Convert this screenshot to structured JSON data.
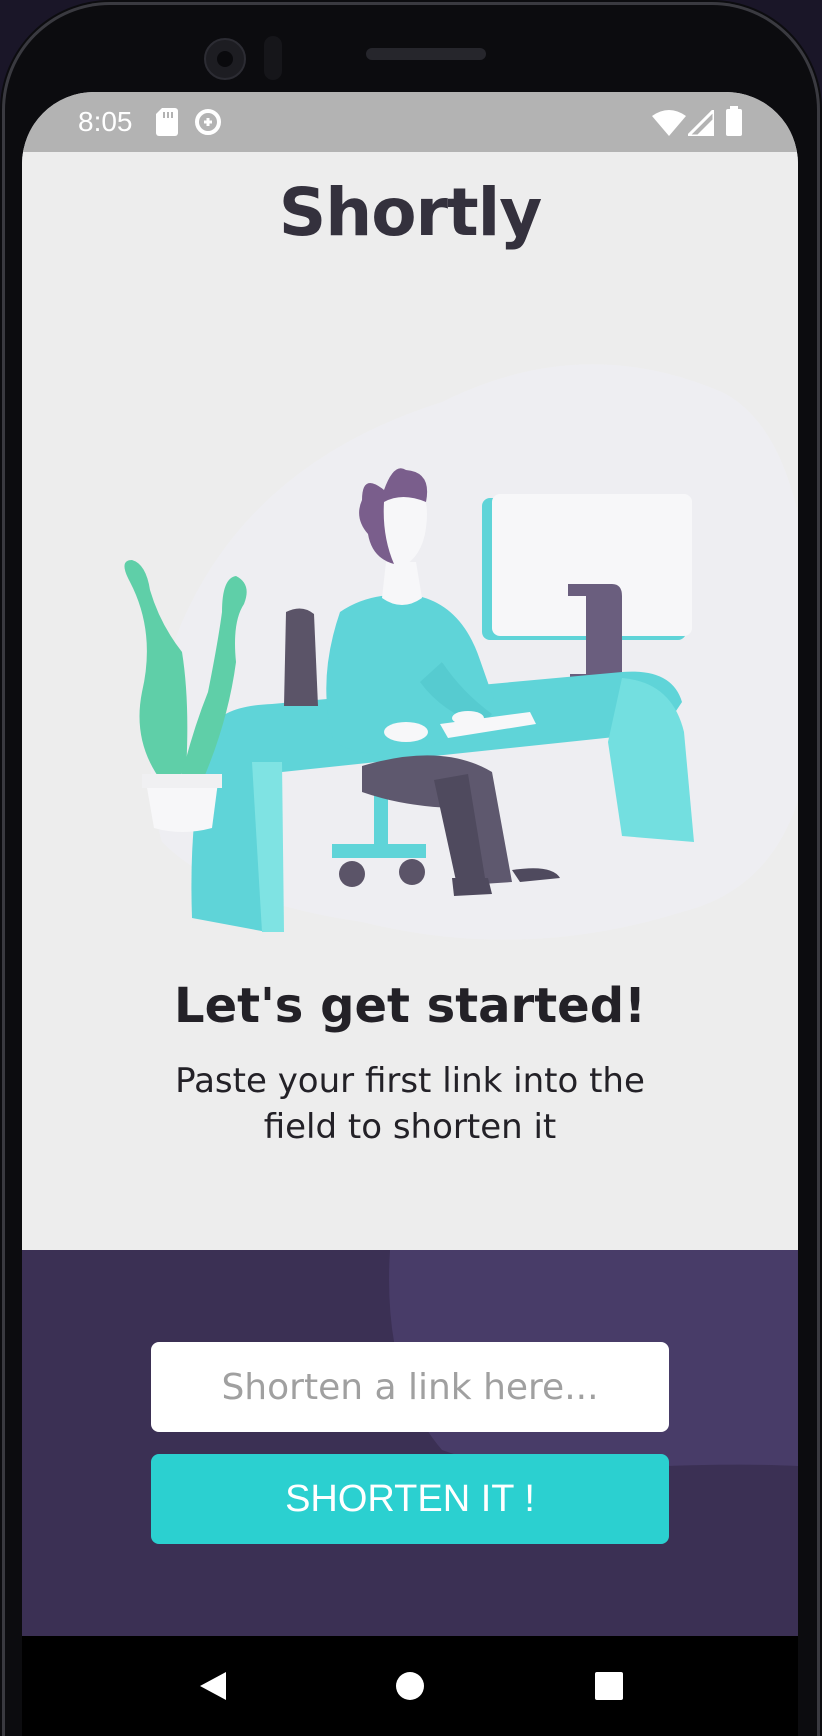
{
  "status_bar": {
    "time": "8:05",
    "left_icons": [
      "sd-card-icon",
      "data-saver-icon"
    ],
    "right_icons": [
      "wifi-icon",
      "cellular-signal-icon",
      "battery-icon"
    ]
  },
  "app": {
    "title": "Shortly",
    "illustration": "person-working-at-desk-illustration",
    "headline": "Let's get started!",
    "subtext": "Paste your first link into the field to shorten it"
  },
  "form": {
    "input_value": "",
    "input_placeholder": "Shorten a link here...",
    "button_label": "SHORTEN IT !"
  },
  "navigation_bar": {
    "buttons": [
      "back-icon",
      "home-icon",
      "recents-icon"
    ]
  },
  "colors": {
    "title_text": "#34313d",
    "panel_background": "#3b3054",
    "button_cyan": "#2bd0d0",
    "content_background": "#ededed"
  }
}
